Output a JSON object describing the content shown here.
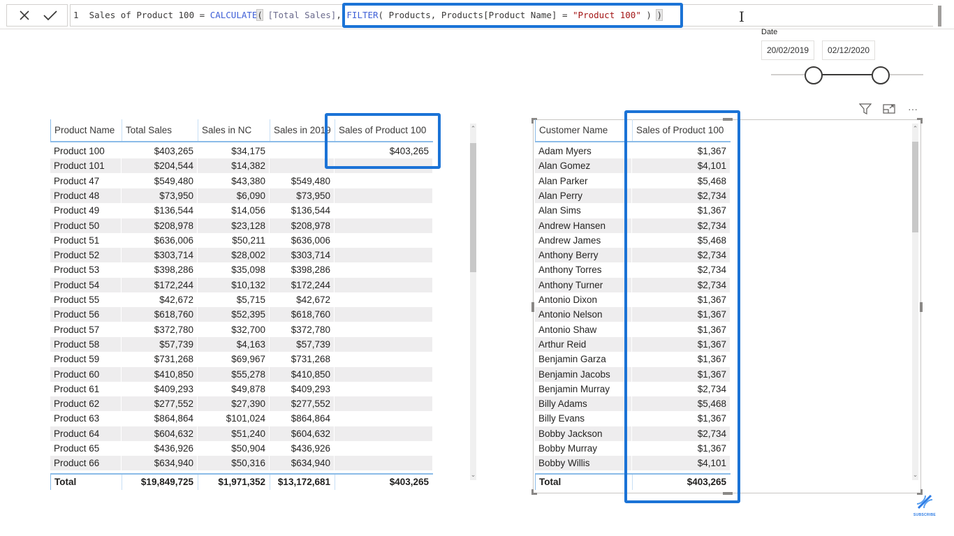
{
  "formula_bar": {
    "line_number": "1",
    "measure_name": "Sales of Product 100",
    "equals": " = ",
    "fn_calculate": "CALCULATE",
    "arg1": "[Total Sales]",
    "fn_filter": "FILTER",
    "filter_table": " Products, Products[Product Name] = ",
    "filter_value": "\"Product 100\"",
    "closing": " ) ",
    "final_paren": ")",
    "cancel_icon": "close-icon",
    "commit_icon": "checkmark-icon"
  },
  "date_slicer": {
    "title": "Date",
    "start_date": "20/02/2019",
    "end_date": "02/12/2020"
  },
  "visual_header": {
    "icons": [
      "filter-icon",
      "focus-mode-icon",
      "more-options-icon"
    ],
    "more_label": "···"
  },
  "product_table": {
    "columns": [
      "Product Name",
      "Total Sales",
      "Sales in NC",
      "Sales in 2019",
      "Sales of Product 100"
    ],
    "rows": [
      [
        "Product 100",
        "$403,265",
        "$34,175",
        "",
        "$403,265"
      ],
      [
        "Product 101",
        "$204,544",
        "$14,382",
        "",
        ""
      ],
      [
        "Product 47",
        "$549,480",
        "$43,380",
        "$549,480",
        ""
      ],
      [
        "Product 48",
        "$73,950",
        "$6,090",
        "$73,950",
        ""
      ],
      [
        "Product 49",
        "$136,544",
        "$14,056",
        "$136,544",
        ""
      ],
      [
        "Product 50",
        "$208,978",
        "$23,128",
        "$208,978",
        ""
      ],
      [
        "Product 51",
        "$636,006",
        "$50,211",
        "$636,006",
        ""
      ],
      [
        "Product 52",
        "$303,714",
        "$28,002",
        "$303,714",
        ""
      ],
      [
        "Product 53",
        "$398,286",
        "$35,098",
        "$398,286",
        ""
      ],
      [
        "Product 54",
        "$172,244",
        "$10,132",
        "$172,244",
        ""
      ],
      [
        "Product 55",
        "$42,672",
        "$5,715",
        "$42,672",
        ""
      ],
      [
        "Product 56",
        "$618,760",
        "$52,395",
        "$618,760",
        ""
      ],
      [
        "Product 57",
        "$372,780",
        "$32,700",
        "$372,780",
        ""
      ],
      [
        "Product 58",
        "$57,739",
        "$4,163",
        "$57,739",
        ""
      ],
      [
        "Product 59",
        "$731,268",
        "$69,967",
        "$731,268",
        ""
      ],
      [
        "Product 60",
        "$410,850",
        "$55,278",
        "$410,850",
        ""
      ],
      [
        "Product 61",
        "$409,293",
        "$49,878",
        "$409,293",
        ""
      ],
      [
        "Product 62",
        "$277,552",
        "$27,390",
        "$277,552",
        ""
      ],
      [
        "Product 63",
        "$864,864",
        "$101,024",
        "$864,864",
        ""
      ],
      [
        "Product 64",
        "$604,632",
        "$51,240",
        "$604,632",
        ""
      ],
      [
        "Product 65",
        "$436,926",
        "$50,904",
        "$436,926",
        ""
      ],
      [
        "Product 66",
        "$634,940",
        "$50,316",
        "$634,940",
        ""
      ]
    ],
    "total": [
      "Total",
      "$19,849,725",
      "$1,971,352",
      "$13,172,681",
      "$403,265"
    ]
  },
  "customer_table": {
    "columns": [
      "Customer Name",
      "Sales of Product 100"
    ],
    "rows": [
      [
        "Adam Myers",
        "$1,367"
      ],
      [
        "Alan Gomez",
        "$4,101"
      ],
      [
        "Alan Parker",
        "$5,468"
      ],
      [
        "Alan Perry",
        "$2,734"
      ],
      [
        "Alan Sims",
        "$1,367"
      ],
      [
        "Andrew Hansen",
        "$2,734"
      ],
      [
        "Andrew James",
        "$5,468"
      ],
      [
        "Anthony Berry",
        "$2,734"
      ],
      [
        "Anthony Torres",
        "$2,734"
      ],
      [
        "Anthony Turner",
        "$2,734"
      ],
      [
        "Antonio Dixon",
        "$1,367"
      ],
      [
        "Antonio Nelson",
        "$1,367"
      ],
      [
        "Antonio Shaw",
        "$1,367"
      ],
      [
        "Arthur Reid",
        "$1,367"
      ],
      [
        "Benjamin Garza",
        "$1,367"
      ],
      [
        "Benjamin Jacobs",
        "$1,367"
      ],
      [
        "Benjamin Murray",
        "$2,734"
      ],
      [
        "Billy Adams",
        "$5,468"
      ],
      [
        "Billy Evans",
        "$1,367"
      ],
      [
        "Bobby Jackson",
        "$2,734"
      ],
      [
        "Bobby Murray",
        "$1,367"
      ],
      [
        "Bobby Willis",
        "$4,101"
      ]
    ],
    "total": [
      "Total",
      "$403,265"
    ]
  },
  "watermark": {
    "label": "SUBSCRIBE",
    "icon": "dna-icon"
  },
  "colors": {
    "highlight": "#1b73d6",
    "dax_keyword": "#3e5fd6",
    "dax_string": "#a31515",
    "header_underline": "#8bbbe8",
    "alt_row": "#eeedee"
  }
}
